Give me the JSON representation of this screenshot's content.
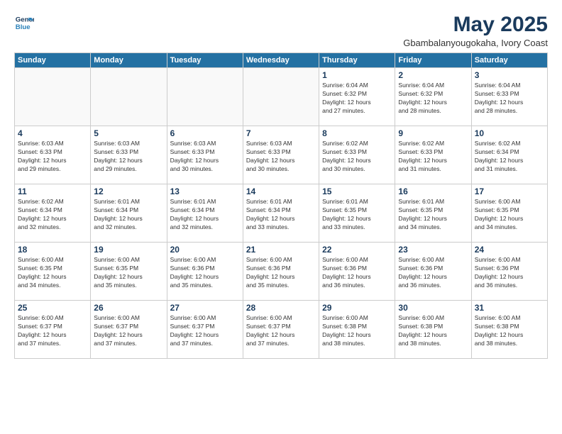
{
  "header": {
    "logo_line1": "General",
    "logo_line2": "Blue",
    "month_year": "May 2025",
    "location": "Gbambalanyougokaha, Ivory Coast"
  },
  "days_of_week": [
    "Sunday",
    "Monday",
    "Tuesday",
    "Wednesday",
    "Thursday",
    "Friday",
    "Saturday"
  ],
  "weeks": [
    [
      {
        "day": "",
        "info": ""
      },
      {
        "day": "",
        "info": ""
      },
      {
        "day": "",
        "info": ""
      },
      {
        "day": "",
        "info": ""
      },
      {
        "day": "1",
        "info": "Sunrise: 6:04 AM\nSunset: 6:32 PM\nDaylight: 12 hours\nand 27 minutes."
      },
      {
        "day": "2",
        "info": "Sunrise: 6:04 AM\nSunset: 6:32 PM\nDaylight: 12 hours\nand 28 minutes."
      },
      {
        "day": "3",
        "info": "Sunrise: 6:04 AM\nSunset: 6:33 PM\nDaylight: 12 hours\nand 28 minutes."
      }
    ],
    [
      {
        "day": "4",
        "info": "Sunrise: 6:03 AM\nSunset: 6:33 PM\nDaylight: 12 hours\nand 29 minutes."
      },
      {
        "day": "5",
        "info": "Sunrise: 6:03 AM\nSunset: 6:33 PM\nDaylight: 12 hours\nand 29 minutes."
      },
      {
        "day": "6",
        "info": "Sunrise: 6:03 AM\nSunset: 6:33 PM\nDaylight: 12 hours\nand 30 minutes."
      },
      {
        "day": "7",
        "info": "Sunrise: 6:03 AM\nSunset: 6:33 PM\nDaylight: 12 hours\nand 30 minutes."
      },
      {
        "day": "8",
        "info": "Sunrise: 6:02 AM\nSunset: 6:33 PM\nDaylight: 12 hours\nand 30 minutes."
      },
      {
        "day": "9",
        "info": "Sunrise: 6:02 AM\nSunset: 6:33 PM\nDaylight: 12 hours\nand 31 minutes."
      },
      {
        "day": "10",
        "info": "Sunrise: 6:02 AM\nSunset: 6:34 PM\nDaylight: 12 hours\nand 31 minutes."
      }
    ],
    [
      {
        "day": "11",
        "info": "Sunrise: 6:02 AM\nSunset: 6:34 PM\nDaylight: 12 hours\nand 32 minutes."
      },
      {
        "day": "12",
        "info": "Sunrise: 6:01 AM\nSunset: 6:34 PM\nDaylight: 12 hours\nand 32 minutes."
      },
      {
        "day": "13",
        "info": "Sunrise: 6:01 AM\nSunset: 6:34 PM\nDaylight: 12 hours\nand 32 minutes."
      },
      {
        "day": "14",
        "info": "Sunrise: 6:01 AM\nSunset: 6:34 PM\nDaylight: 12 hours\nand 33 minutes."
      },
      {
        "day": "15",
        "info": "Sunrise: 6:01 AM\nSunset: 6:35 PM\nDaylight: 12 hours\nand 33 minutes."
      },
      {
        "day": "16",
        "info": "Sunrise: 6:01 AM\nSunset: 6:35 PM\nDaylight: 12 hours\nand 34 minutes."
      },
      {
        "day": "17",
        "info": "Sunrise: 6:00 AM\nSunset: 6:35 PM\nDaylight: 12 hours\nand 34 minutes."
      }
    ],
    [
      {
        "day": "18",
        "info": "Sunrise: 6:00 AM\nSunset: 6:35 PM\nDaylight: 12 hours\nand 34 minutes."
      },
      {
        "day": "19",
        "info": "Sunrise: 6:00 AM\nSunset: 6:35 PM\nDaylight: 12 hours\nand 35 minutes."
      },
      {
        "day": "20",
        "info": "Sunrise: 6:00 AM\nSunset: 6:36 PM\nDaylight: 12 hours\nand 35 minutes."
      },
      {
        "day": "21",
        "info": "Sunrise: 6:00 AM\nSunset: 6:36 PM\nDaylight: 12 hours\nand 35 minutes."
      },
      {
        "day": "22",
        "info": "Sunrise: 6:00 AM\nSunset: 6:36 PM\nDaylight: 12 hours\nand 36 minutes."
      },
      {
        "day": "23",
        "info": "Sunrise: 6:00 AM\nSunset: 6:36 PM\nDaylight: 12 hours\nand 36 minutes."
      },
      {
        "day": "24",
        "info": "Sunrise: 6:00 AM\nSunset: 6:36 PM\nDaylight: 12 hours\nand 36 minutes."
      }
    ],
    [
      {
        "day": "25",
        "info": "Sunrise: 6:00 AM\nSunset: 6:37 PM\nDaylight: 12 hours\nand 37 minutes."
      },
      {
        "day": "26",
        "info": "Sunrise: 6:00 AM\nSunset: 6:37 PM\nDaylight: 12 hours\nand 37 minutes."
      },
      {
        "day": "27",
        "info": "Sunrise: 6:00 AM\nSunset: 6:37 PM\nDaylight: 12 hours\nand 37 minutes."
      },
      {
        "day": "28",
        "info": "Sunrise: 6:00 AM\nSunset: 6:37 PM\nDaylight: 12 hours\nand 37 minutes."
      },
      {
        "day": "29",
        "info": "Sunrise: 6:00 AM\nSunset: 6:38 PM\nDaylight: 12 hours\nand 38 minutes."
      },
      {
        "day": "30",
        "info": "Sunrise: 6:00 AM\nSunset: 6:38 PM\nDaylight: 12 hours\nand 38 minutes."
      },
      {
        "day": "31",
        "info": "Sunrise: 6:00 AM\nSunset: 6:38 PM\nDaylight: 12 hours\nand 38 minutes."
      }
    ]
  ]
}
